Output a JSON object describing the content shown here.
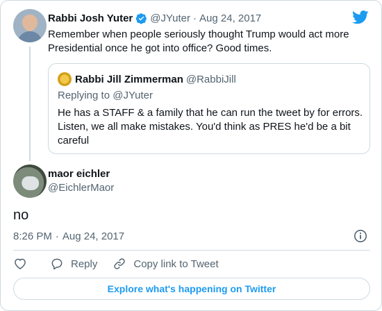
{
  "colors": {
    "twitter_blue": "#1d9bf0",
    "text": "#0f1419",
    "muted": "#536471",
    "border": "#cfd9de"
  },
  "parent_tweet": {
    "author_name": "Rabbi Josh Yuter",
    "verified_icon": "verified-badge-icon",
    "handle": "@JYuter",
    "separator": "·",
    "date": "Aug 24, 2017",
    "text": "Remember when people seriously thought Trump would act more Presidential once he got into office? Good times."
  },
  "quoted_tweet": {
    "author_name": "Rabbi Jill Zimmerman",
    "handle": "@RabbiJill",
    "replying_to": "Replying to @JYuter",
    "text": "He has a STAFF & a family that he can run the tweet by for errors. Listen, we all make mistakes. You'd think as PRES he'd be a bit careful"
  },
  "main_tweet": {
    "author_name": "maor eichler",
    "handle": "@EichlerMaor",
    "text": "no",
    "time": "8:26 PM",
    "separator": "·",
    "date": "Aug 24, 2017"
  },
  "actions": {
    "like_icon": "heart-icon",
    "reply_icon": "reply-bubble-icon",
    "reply_label": "Reply",
    "copy_icon": "link-icon",
    "copy_label": "Copy link to Tweet"
  },
  "explore_button": {
    "label": "Explore what's happening on Twitter"
  }
}
